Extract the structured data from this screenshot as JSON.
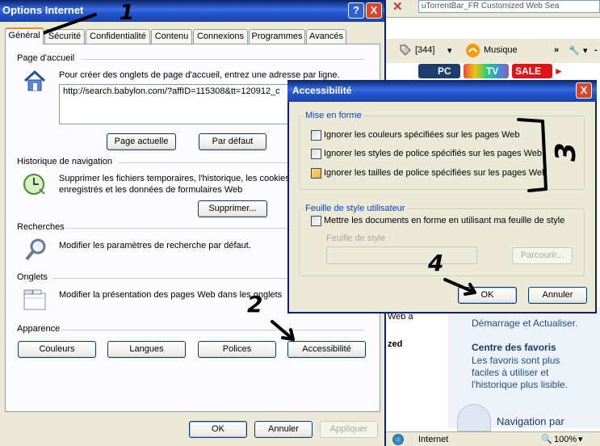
{
  "browser": {
    "search_text": "uTorrentBar_FR Customized Web Sea",
    "count_label": "[344]",
    "music_label": "Musique",
    "overflow": "»",
    "tile_pc": "PC",
    "tile_tv": "TV",
    "tile_sale": "SALE",
    "tile_sale_arrow": "►",
    "web_a": "Web a",
    "zed": "zed",
    "pane_line1": "Démarrage et Actualiser.",
    "pane_heading": "Centre des favoris",
    "pane_line2": "Les favoris sont plus",
    "pane_line3": "faciles à utiliser et",
    "pane_line4": "l'historique plus lisible.",
    "pane_nav": "Navigation par",
    "status_internet": "Internet",
    "status_zoom": "100%"
  },
  "options": {
    "title": "Options Internet",
    "help_btn": "?",
    "close_btn": "X",
    "tabs": [
      "Général",
      "Sécurité",
      "Confidentialité",
      "Contenu",
      "Connexions",
      "Programmes",
      "Avancés"
    ],
    "home": {
      "label": "Page d'accueil",
      "desc": "Pour créer des onglets de page d'accueil, entrez une adresse par ligne.",
      "url": "http://search.babylon.com/?affID=115308&tt=120912_c",
      "btn_current": "Page actuelle",
      "btn_default": "Par défaut"
    },
    "history": {
      "label": "Historique de navigation",
      "desc1": "Supprimer les fichiers temporaires, l'historique, les cookies,",
      "desc2": "enregistrés et les données de formulaires Web",
      "btn_delete": "Supprimer..."
    },
    "search": {
      "label": "Recherches",
      "desc": "Modifier les paramètres de recherche par défaut."
    },
    "tabs_section": {
      "label": "Onglets",
      "desc": "Modifier la présentation des pages Web dans les onglets"
    },
    "appearance": {
      "label": "Apparence",
      "btn_colors": "Couleurs",
      "btn_languages": "Langues",
      "btn_fonts": "Polices",
      "btn_accessibility": "Accessibilité"
    },
    "btn_ok": "OK",
    "btn_cancel": "Annuler",
    "btn_apply": "Appliquer"
  },
  "accessibility": {
    "title": "Accessibilité",
    "close_btn": "X",
    "format_group": "Mise en forme",
    "cb1": "Ignorer les couleurs spécifiées sur les pages Web",
    "cb2": "Ignorer les styles de police spécifiés sur les pages Web",
    "cb3": "Ignorer les tailles de police spécifiées sur les pages Web",
    "stylesheet_group": "Feuille de style utilisateur",
    "cb4": "Mettre les documents en forme en utilisant ma feuille de style",
    "stylesheet_label": "Feuille de style :",
    "btn_browse": "Parcourir...",
    "btn_ok": "OK",
    "btn_cancel": "Annuler"
  },
  "annotations": {
    "n1": "1",
    "n2": "2",
    "n3": "3",
    "n4": "4"
  },
  "colors": {
    "xp_title_blue": "#2859d6",
    "xp_close_red": "#d8472b",
    "tab_highlight": "#e68b2c",
    "group_legend_blue": "#0046d5"
  }
}
